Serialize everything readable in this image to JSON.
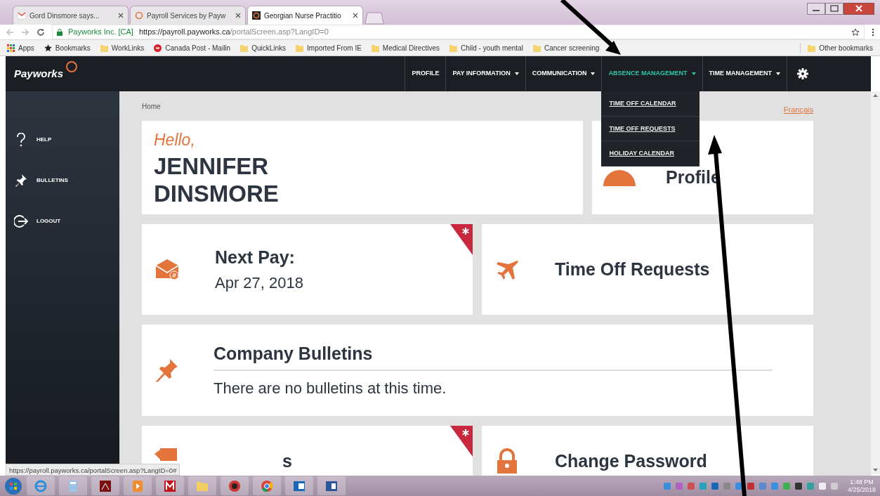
{
  "browser": {
    "tabs": [
      {
        "title": "Gord Dinsmore says...",
        "selected": false
      },
      {
        "title": "Payroll Services by Payw",
        "selected": false
      },
      {
        "title": "Georgian Nurse Practitio",
        "selected": true
      }
    ],
    "address": {
      "site": "Payworks Inc. [CA]",
      "host": "https://payroll.payworks.ca",
      "path": "/portalScreen.asp?LangID=0"
    },
    "bookmarks": [
      "Apps",
      "Bookmarks",
      "WorkLinks",
      "Canada Post - Mailin",
      "QuickLinks",
      "Imported From IE",
      "Medical Directives",
      "Child - youth mental",
      "Cancer screening"
    ],
    "other_bookmarks": "Other bookmarks",
    "status_url": "https://payroll.payworks.ca/portalScreen.asp?LangID=0#"
  },
  "app": {
    "logo": "Payworks",
    "nav": [
      {
        "label": "PROFILE",
        "dropdown": false,
        "selected": false
      },
      {
        "label": "PAY INFORMATION",
        "dropdown": true,
        "selected": false
      },
      {
        "label": "COMMUNICATION",
        "dropdown": true,
        "selected": false
      },
      {
        "label": "ABSENCE MANAGEMENT",
        "dropdown": true,
        "selected": true
      },
      {
        "label": "TIME MANAGEMENT",
        "dropdown": true,
        "selected": false
      }
    ],
    "open_menu": [
      "TIME OFF CALENDAR",
      "TIME OFF REQUESTS",
      "HOLIDAY CALENDAR"
    ],
    "sidebar": [
      "HELP",
      "BULLETINS",
      "LOGOUT"
    ],
    "breadcrumb": "Home",
    "language_link": "Français",
    "greeting": "Hello,",
    "name_lines": [
      "JENNIFER",
      "DINSMORE"
    ],
    "profile_card": {
      "title": "Profile"
    },
    "tiles": [
      {
        "title": "Next Pay:",
        "subtitle": "Apr 27, 2018",
        "flag": true
      },
      {
        "title": "Time Off Requests",
        "flag": false
      }
    ],
    "bulletins": {
      "title": "Company Bulletins",
      "text": "There are no bulletins at this time."
    },
    "bottom_tiles": [
      {
        "title": "s",
        "flag": true
      },
      {
        "title": "Change Password",
        "flag": false
      }
    ]
  },
  "taskbar": {
    "clock": {
      "time": "1:48 PM",
      "date": "4/25/2018"
    }
  }
}
